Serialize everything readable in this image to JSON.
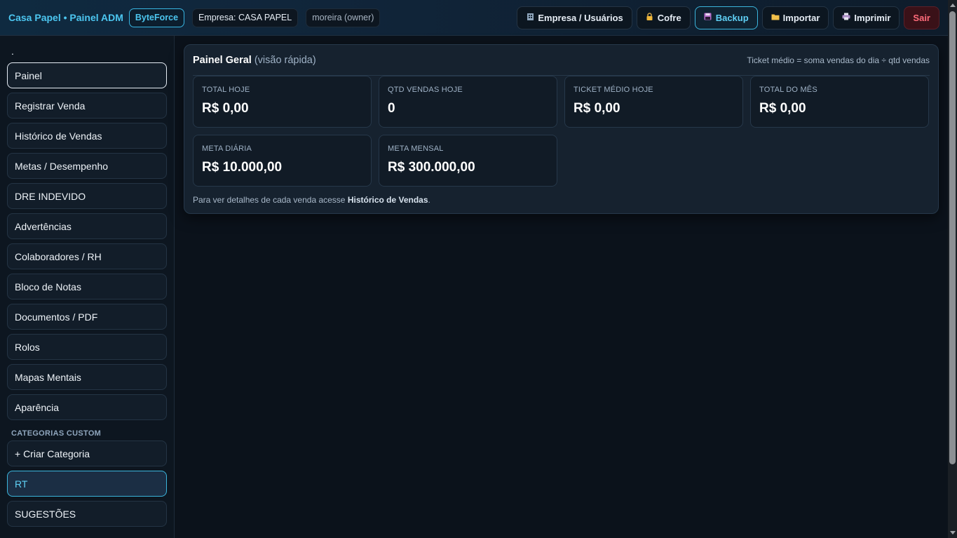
{
  "header": {
    "brand": "Casa Papel • Painel ADM",
    "badge": "ByteForce",
    "empresa": "Empresa: CASA PAPEL",
    "user": "moreira (owner)",
    "buttons": {
      "empresa_usuarios": "Empresa / Usuários",
      "cofre": "Cofre",
      "backup": "Backup",
      "importar": "Importar",
      "imprimir": "Imprimir",
      "sair": "Sair"
    },
    "icons": {
      "empresa_usuarios": "building-icon",
      "cofre": "lock-icon",
      "backup": "floppy-disk-icon",
      "importar": "folder-icon",
      "imprimir": "printer-icon"
    }
  },
  "sidebar": {
    "dot": ".",
    "items": [
      "Painel",
      "Registrar Venda",
      "Histórico de Vendas",
      "Metas / Desempenho",
      "DRE INDEVIDO",
      "Advertências",
      "Colaboradores / RH",
      "Bloco de Notas",
      "Documentos / PDF",
      "Rolos",
      "Mapas Mentais",
      "Aparência"
    ],
    "section_label": "CATEGORIAS CUSTOM",
    "custom_items": [
      "+ Criar Categoria",
      "RT",
      "SUGESTÕES"
    ]
  },
  "panel": {
    "title": "Painel Geral",
    "subtitle": "(visão rápida)",
    "note": "Ticket médio = soma vendas do dia ÷ qtd vendas",
    "cards": [
      {
        "label": "TOTAL HOJE",
        "value": "R$ 0,00"
      },
      {
        "label": "QTD VENDAS HOJE",
        "value": "0"
      },
      {
        "label": "TICKET MÉDIO HOJE",
        "value": "R$ 0,00"
      },
      {
        "label": "TOTAL DO MÊS",
        "value": "R$ 0,00"
      },
      {
        "label": "META DIÁRIA",
        "value": "R$ 10.000,00"
      },
      {
        "label": "META MENSAL",
        "value": "R$ 300.000,00"
      }
    ],
    "footer_prefix": "Para ver detalhes de cada venda acesse ",
    "footer_link": "Histórico de Vendas",
    "footer_suffix": "."
  },
  "colors": {
    "accent": "#4cc6f0",
    "background": "#0b121b",
    "danger": "#ff6b7a"
  }
}
